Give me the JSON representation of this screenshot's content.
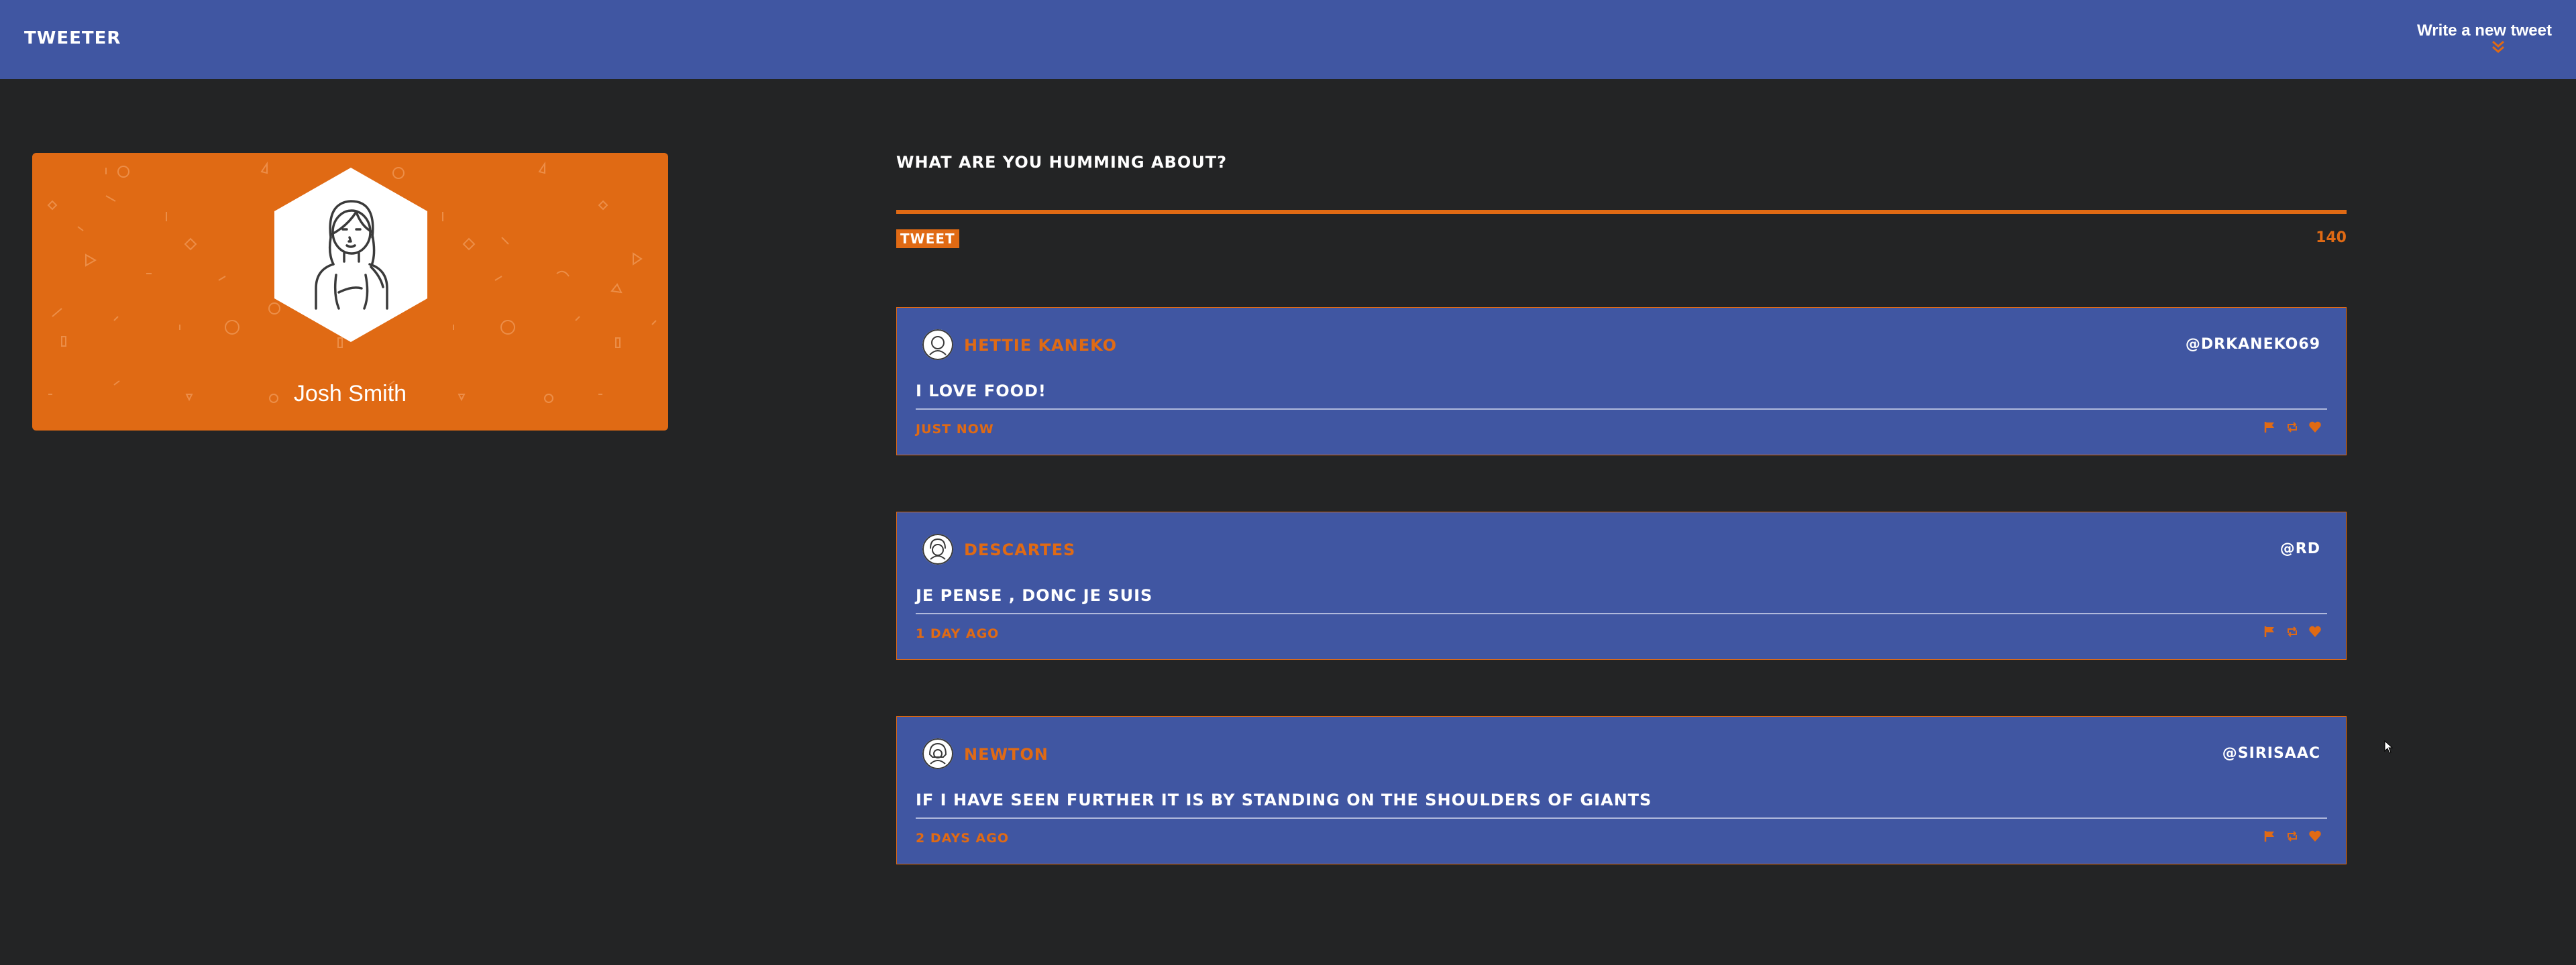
{
  "nav": {
    "brand": "Tweeter",
    "compose_label": "Write a new tweet",
    "compose_icon": "double-chevron-down-icon"
  },
  "profile": {
    "name": "Josh Smith",
    "avatar_icon": "person-avatar-icon"
  },
  "compose": {
    "question": "What are you humming about?",
    "button_label": "Tweet",
    "counter": "140"
  },
  "tweets": [
    {
      "name": "Hettie Kaneko",
      "handle": "@DRKANEKO69",
      "text": "I love food!",
      "time": "Just now"
    },
    {
      "name": "Descartes",
      "handle": "@rd",
      "text": "Je pense , donc je suis",
      "time": "1 day ago"
    },
    {
      "name": "Newton",
      "handle": "@SirIsaac",
      "text": "If I have seen further it is by standing on the shoulders of giants",
      "time": "2 days ago"
    }
  ],
  "colors": {
    "nav": "#4056a2",
    "accent": "#e06a14",
    "background": "#232425",
    "card": "#4056a2"
  }
}
